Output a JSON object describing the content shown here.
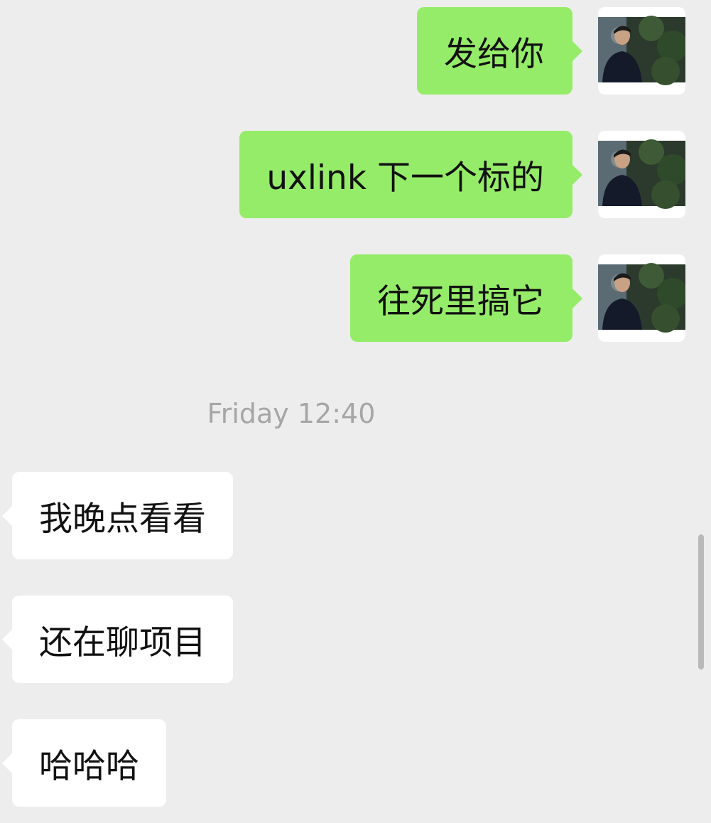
{
  "colors": {
    "background": "#ededed",
    "outgoing_bubble": "#95ec69",
    "incoming_bubble": "#ffffff",
    "timestamp_text": "#a6a6a6",
    "scrollbar": "#b9b9b9"
  },
  "outgoing_messages": [
    {
      "text": "发给你",
      "avatar": "user-photo-avatar"
    },
    {
      "text": "uxlink 下一个标的",
      "avatar": "user-photo-avatar"
    },
    {
      "text": "往死里搞它",
      "avatar": "user-photo-avatar"
    }
  ],
  "timestamp": "Friday 12:40",
  "incoming_messages": [
    {
      "text": "我晚点看看"
    },
    {
      "text": "还在聊项目"
    },
    {
      "text": "哈哈哈"
    }
  ]
}
